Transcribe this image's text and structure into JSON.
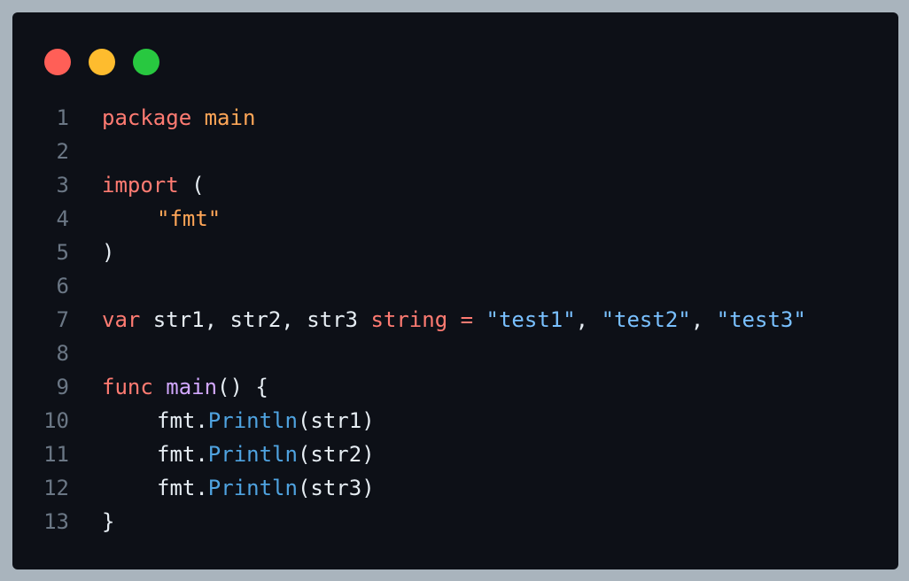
{
  "window": {
    "controls": [
      {
        "name": "close",
        "color": "#ff5f57"
      },
      {
        "name": "minimize",
        "color": "#febc2e"
      },
      {
        "name": "maximize",
        "color": "#28c840"
      }
    ]
  },
  "colors": {
    "keyword": "#ff7b72",
    "string": "#79c0ff",
    "function": "#d2a8ff",
    "method": "#4fa3e0",
    "plain": "#e6edf3",
    "line_number": "#6b7785",
    "package": "#ffa657",
    "import_string": "#ffa657"
  },
  "code": {
    "lines": [
      {
        "n": "1",
        "indent": 0,
        "tokens": [
          {
            "t": "package",
            "c": "keyword"
          },
          {
            "t": " ",
            "c": "plain"
          },
          {
            "t": "main",
            "c": "package"
          }
        ]
      },
      {
        "n": "2",
        "indent": 0,
        "tokens": []
      },
      {
        "n": "3",
        "indent": 0,
        "tokens": [
          {
            "t": "import",
            "c": "keyword"
          },
          {
            "t": " (",
            "c": "plain"
          }
        ]
      },
      {
        "n": "4",
        "indent": 1,
        "tokens": [
          {
            "t": "\"fmt\"",
            "c": "import_string"
          }
        ]
      },
      {
        "n": "5",
        "indent": 0,
        "tokens": [
          {
            "t": ")",
            "c": "plain"
          }
        ]
      },
      {
        "n": "6",
        "indent": 0,
        "tokens": []
      },
      {
        "n": "7",
        "indent": 0,
        "tokens": [
          {
            "t": "var",
            "c": "keyword"
          },
          {
            "t": " str1, str2, str3 ",
            "c": "plain"
          },
          {
            "t": "string",
            "c": "keyword"
          },
          {
            "t": " ",
            "c": "plain"
          },
          {
            "t": "=",
            "c": "keyword"
          },
          {
            "t": " ",
            "c": "plain"
          },
          {
            "t": "\"test1\"",
            "c": "string"
          },
          {
            "t": ", ",
            "c": "plain"
          },
          {
            "t": "\"test2\"",
            "c": "string"
          },
          {
            "t": ", ",
            "c": "plain"
          },
          {
            "t": "\"test3\"",
            "c": "string"
          }
        ]
      },
      {
        "n": "8",
        "indent": 0,
        "tokens": []
      },
      {
        "n": "9",
        "indent": 0,
        "tokens": [
          {
            "t": "func",
            "c": "keyword"
          },
          {
            "t": " ",
            "c": "plain"
          },
          {
            "t": "main",
            "c": "function"
          },
          {
            "t": "() {",
            "c": "plain"
          }
        ]
      },
      {
        "n": "10",
        "indent": 1,
        "tokens": [
          {
            "t": "fmt.",
            "c": "plain"
          },
          {
            "t": "Println",
            "c": "method"
          },
          {
            "t": "(str1)",
            "c": "plain"
          }
        ]
      },
      {
        "n": "11",
        "indent": 1,
        "tokens": [
          {
            "t": "fmt.",
            "c": "plain"
          },
          {
            "t": "Println",
            "c": "method"
          },
          {
            "t": "(str2)",
            "c": "plain"
          }
        ]
      },
      {
        "n": "12",
        "indent": 1,
        "tokens": [
          {
            "t": "fmt.",
            "c": "plain"
          },
          {
            "t": "Println",
            "c": "method"
          },
          {
            "t": "(str3)",
            "c": "plain"
          }
        ]
      },
      {
        "n": "13",
        "indent": 0,
        "tokens": [
          {
            "t": "}",
            "c": "plain"
          }
        ]
      }
    ]
  }
}
